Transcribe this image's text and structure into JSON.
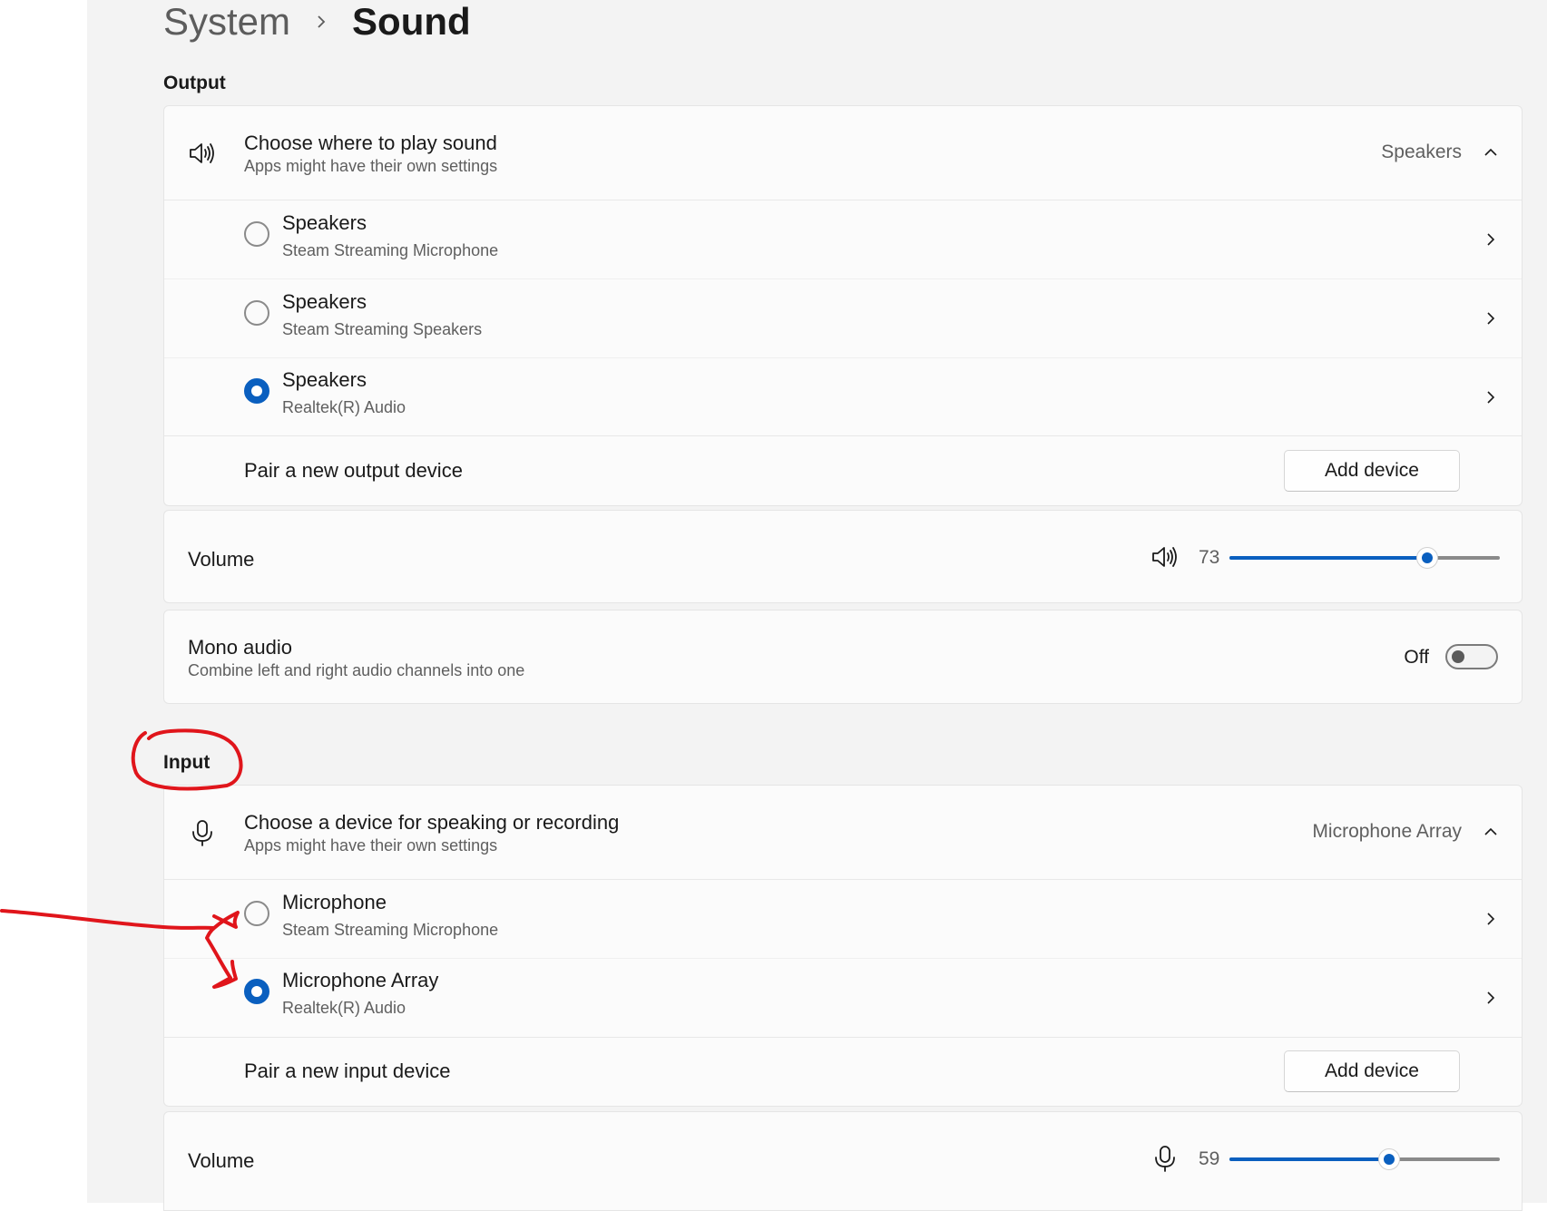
{
  "breadcrumb": {
    "parent": "System",
    "separator_icon": "chevron-right-icon",
    "current": "Sound"
  },
  "output": {
    "section_title": "Output",
    "chooser": {
      "title": "Choose where to play sound",
      "subtitle": "Apps might have their own settings",
      "selected_value": "Speakers",
      "icon": "speaker-icon"
    },
    "devices": [
      {
        "name": "Speakers",
        "detail": "Steam Streaming Microphone",
        "selected": false
      },
      {
        "name": "Speakers",
        "detail": "Steam Streaming Speakers",
        "selected": false
      },
      {
        "name": "Speakers",
        "detail": "Realtek(R) Audio",
        "selected": true
      }
    ],
    "pair": {
      "label": "Pair a new output device",
      "button": "Add device"
    },
    "volume": {
      "label": "Volume",
      "value": "73",
      "percent": 73,
      "icon": "speaker-icon"
    },
    "mono": {
      "title": "Mono audio",
      "subtitle": "Combine left and right audio channels into one",
      "state": "Off"
    }
  },
  "input": {
    "section_title": "Input",
    "chooser": {
      "title": "Choose a device for speaking or recording",
      "subtitle": "Apps might have their own settings",
      "selected_value": "Microphone Array",
      "icon": "microphone-icon"
    },
    "devices": [
      {
        "name": "Microphone",
        "detail": "Steam Streaming Microphone",
        "selected": false
      },
      {
        "name": "Microphone Array",
        "detail": "Realtek(R) Audio",
        "selected": true
      }
    ],
    "pair": {
      "label": "Pair a new input device",
      "button": "Add device"
    },
    "volume": {
      "label": "Volume",
      "value": "59",
      "percent": 59,
      "icon": "microphone-icon"
    }
  },
  "colors": {
    "accent": "#0a5fbf",
    "annotation": "#e0151b",
    "page_bg": "#f3f3f3",
    "card_bg": "#fbfbfb"
  }
}
